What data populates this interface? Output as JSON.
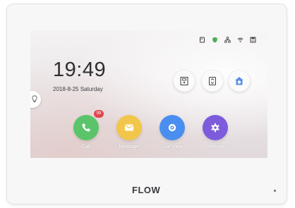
{
  "status_icons": [
    "sd-card-icon",
    "shield-icon",
    "network-icon",
    "wifi-icon",
    "storage-icon"
  ],
  "home": {
    "time": "19:49",
    "date": "2018-8-25  Saturday"
  },
  "quick_actions": [
    {
      "name": "door-unlock-icon"
    },
    {
      "name": "elevator-icon"
    },
    {
      "name": "arm-home-icon"
    }
  ],
  "apps": [
    {
      "label": "Call",
      "color": "#5bc46a",
      "icon": "phone-icon",
      "badge": "99"
    },
    {
      "label": "Message",
      "color": "#f2c64a",
      "icon": "envelope-icon"
    },
    {
      "label": "Live View",
      "color": "#4a8ff0",
      "icon": "camera-icon"
    },
    {
      "label": "Settings",
      "color": "#7c5cdc",
      "icon": "gear-icon"
    }
  ],
  "brand": "FLOW"
}
